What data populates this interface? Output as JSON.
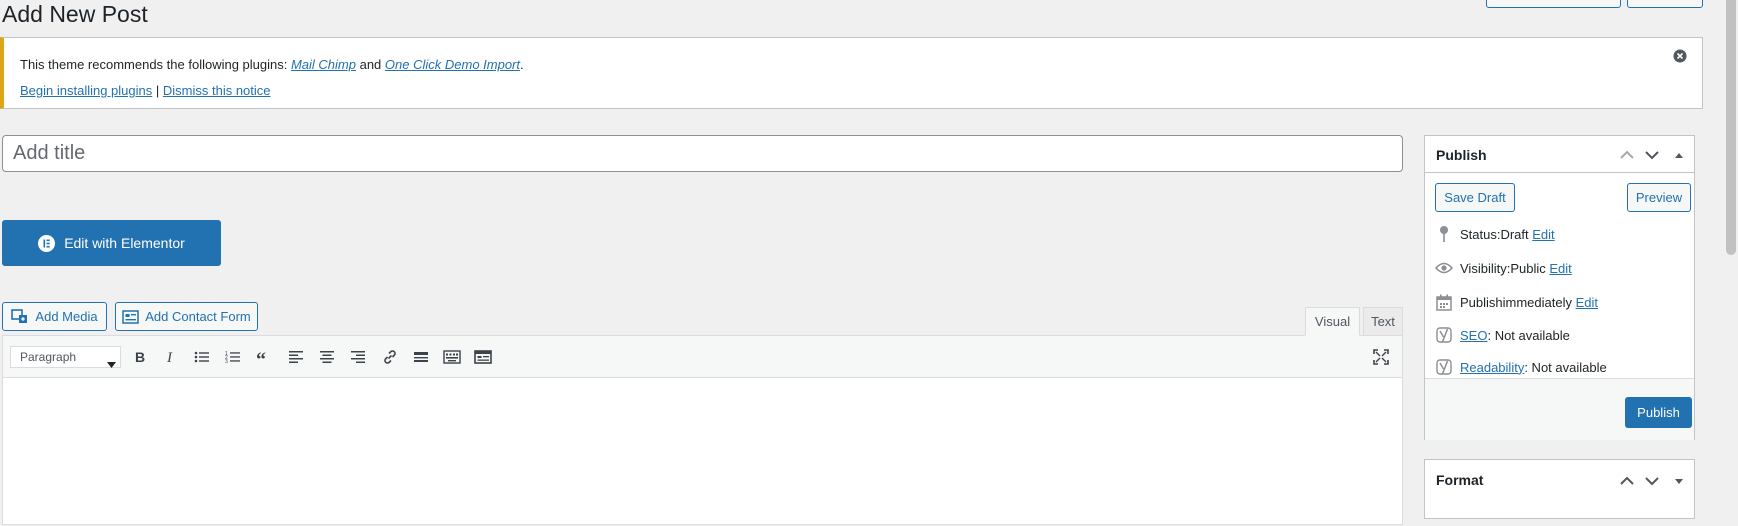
{
  "page": {
    "title": "Add New Post"
  },
  "notice": {
    "prefix": "This theme recommends the following plugins: ",
    "plugin_1": "Mail Chimp",
    "and": " and ",
    "plugin_2": "One Click Demo Import",
    "suffix": ".",
    "begin_link": "Begin installing plugins",
    "separator": " | ",
    "dismiss_link": "Dismiss this notice"
  },
  "title_input": {
    "placeholder": "Add title",
    "value": ""
  },
  "elementor": {
    "label": "Edit with Elementor"
  },
  "media_buttons": {
    "add_media": "Add Media",
    "add_contact_form": "Add Contact Form"
  },
  "editor": {
    "tabs": [
      "Visual",
      "Text"
    ],
    "active_tab": "Visual",
    "format_select": {
      "value": "Paragraph",
      "options": [
        "Paragraph"
      ]
    },
    "toolbar_icons": [
      "bold-icon",
      "italic-icon",
      "bulleted-list-icon",
      "numbered-list-icon",
      "blockquote-icon",
      "align-left-icon",
      "align-center-icon",
      "align-right-icon",
      "link-icon",
      "read-more-icon",
      "toolbar-toggle-icon",
      "contact-form-icon",
      "fullscreen-icon"
    ]
  },
  "publish_box": {
    "title": "Publish",
    "save_draft": "Save Draft",
    "preview": "Preview",
    "status_label": "Status: ",
    "status_value": "Draft",
    "visibility_label": "Visibility: ",
    "visibility_value": "Public",
    "publish_label": "Publish ",
    "publish_value": "immediately",
    "edit": "Edit",
    "seo_link": "SEO",
    "seo_value": ": Not available",
    "readability_link": "Readability",
    "readability_value": ": Not available",
    "publish_button": "Publish"
  },
  "format_box": {
    "title": "Format"
  },
  "colors": {
    "accent": "#2271b1",
    "notice_border": "#dba617",
    "background": "#f0f0f1"
  }
}
